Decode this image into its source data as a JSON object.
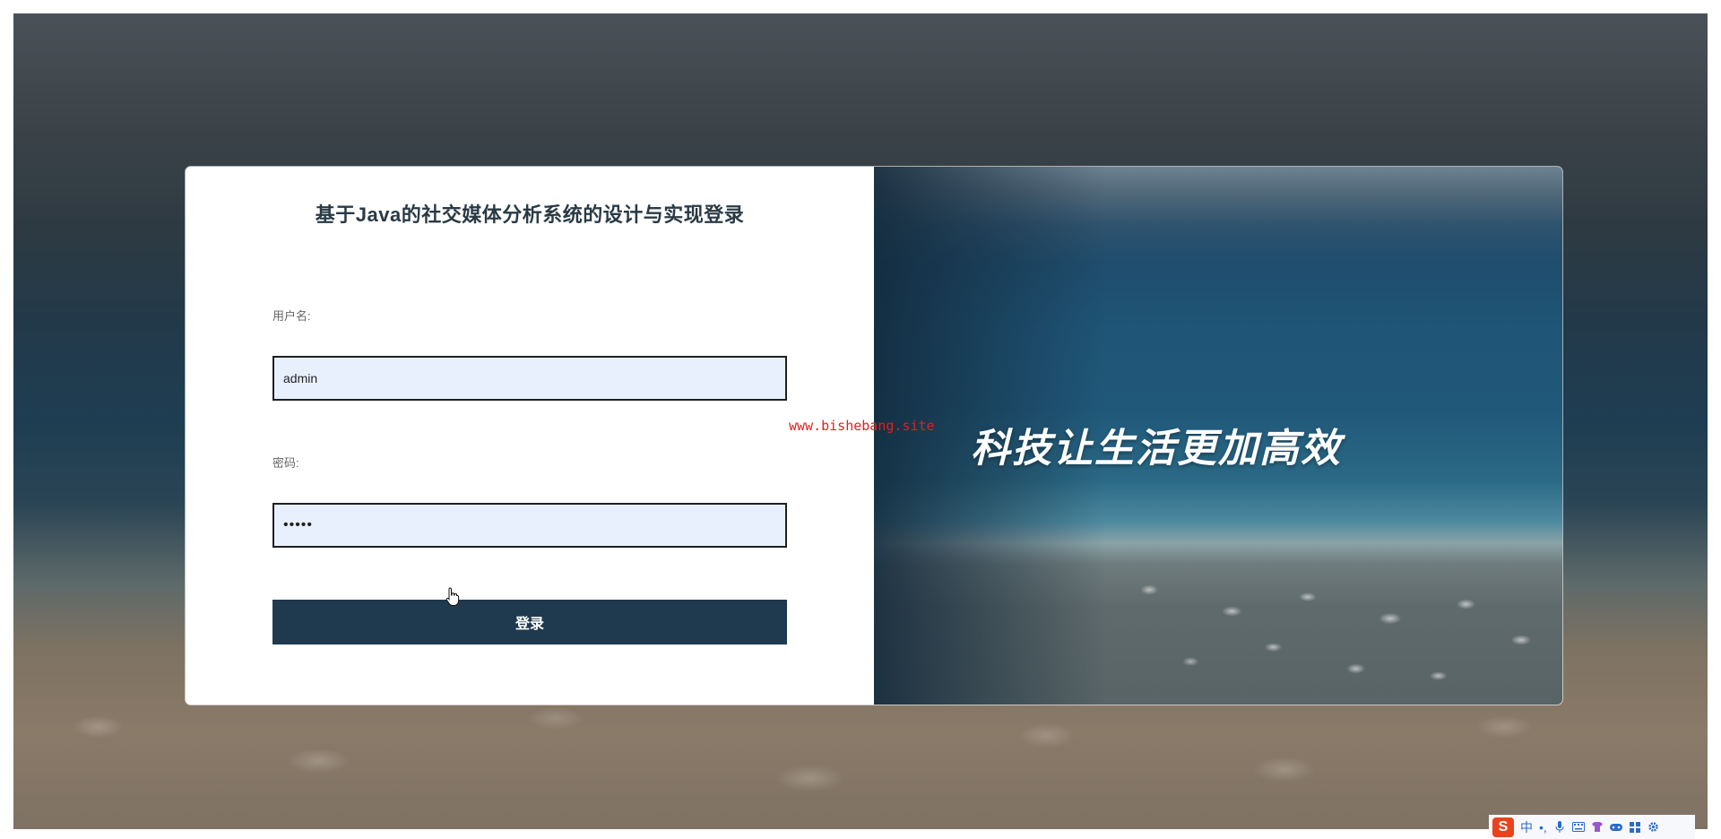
{
  "login": {
    "title": "基于Java的社交媒体分析系统的设计与实现登录",
    "username_label": "用户名:",
    "username_value": "admin",
    "password_label": "密码:",
    "password_value": "•••••",
    "submit_label": "登录"
  },
  "banner": {
    "slogan": "科技让生活更加高效"
  },
  "watermark": "www.bishebang.site",
  "ime": {
    "logo": "S",
    "lang": "中",
    "punct": "•,",
    "icons": [
      "mic-icon",
      "keyboard-icon",
      "skin-icon",
      "game-icon",
      "grid-icon",
      "settings-icon"
    ]
  },
  "colors": {
    "button_bg": "#1f3a4f",
    "input_bg": "#e8f0fe",
    "watermark": "#e0201c"
  }
}
